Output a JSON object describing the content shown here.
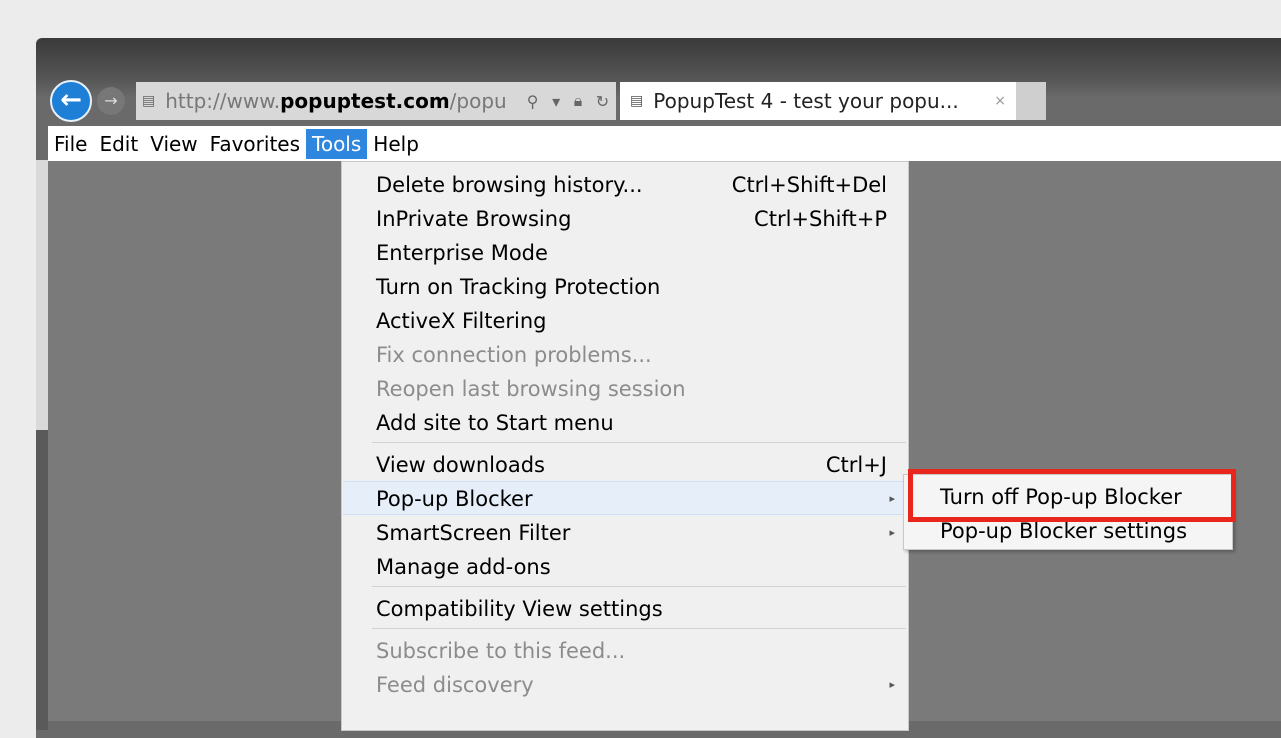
{
  "browser": {
    "address": {
      "prefix": "http://www.",
      "domain": "popuptest.com",
      "suffix": "/popu"
    },
    "tab": {
      "title": "PopupTest 4 - test your popu...",
      "close_icon": "×"
    }
  },
  "menubar": {
    "items": [
      {
        "label": "File"
      },
      {
        "label": "Edit"
      },
      {
        "label": "View"
      },
      {
        "label": "Favorites"
      },
      {
        "label": "Tools",
        "active": true
      },
      {
        "label": "Help"
      }
    ]
  },
  "tools_menu": {
    "items": [
      {
        "label": "Delete browsing history...",
        "shortcut": "Ctrl+Shift+Del"
      },
      {
        "label": "InPrivate Browsing",
        "shortcut": "Ctrl+Shift+P"
      },
      {
        "label": "Enterprise Mode",
        "shortcut": ""
      },
      {
        "label": "Turn on Tracking Protection",
        "shortcut": ""
      },
      {
        "label": "ActiveX Filtering",
        "shortcut": ""
      },
      {
        "label": "Fix connection problems...",
        "shortcut": "",
        "disabled": true
      },
      {
        "label": "Reopen last browsing session",
        "shortcut": "",
        "disabled": true
      },
      {
        "label": "Add site to Start menu",
        "shortcut": ""
      },
      {
        "label": "View downloads",
        "shortcut": "Ctrl+J"
      },
      {
        "label": "Pop-up Blocker",
        "shortcut": "",
        "submenu": true,
        "hover": true
      },
      {
        "label": "SmartScreen Filter",
        "shortcut": "",
        "submenu": true
      },
      {
        "label": "Manage add-ons",
        "shortcut": ""
      },
      {
        "label": "Compatibility View settings",
        "shortcut": ""
      },
      {
        "label": "Subscribe to this feed...",
        "shortcut": "",
        "disabled": true
      },
      {
        "label": "Feed discovery",
        "shortcut": "",
        "disabled": true,
        "submenu": true
      }
    ]
  },
  "popup_submenu": {
    "items": [
      {
        "label": "Turn off Pop-up Blocker"
      },
      {
        "label": "Pop-up Blocker settings"
      }
    ]
  },
  "colors": {
    "menu_active": "#2e86de",
    "highlight_box": "#e8261b",
    "back_button": "#1e7fd6"
  }
}
